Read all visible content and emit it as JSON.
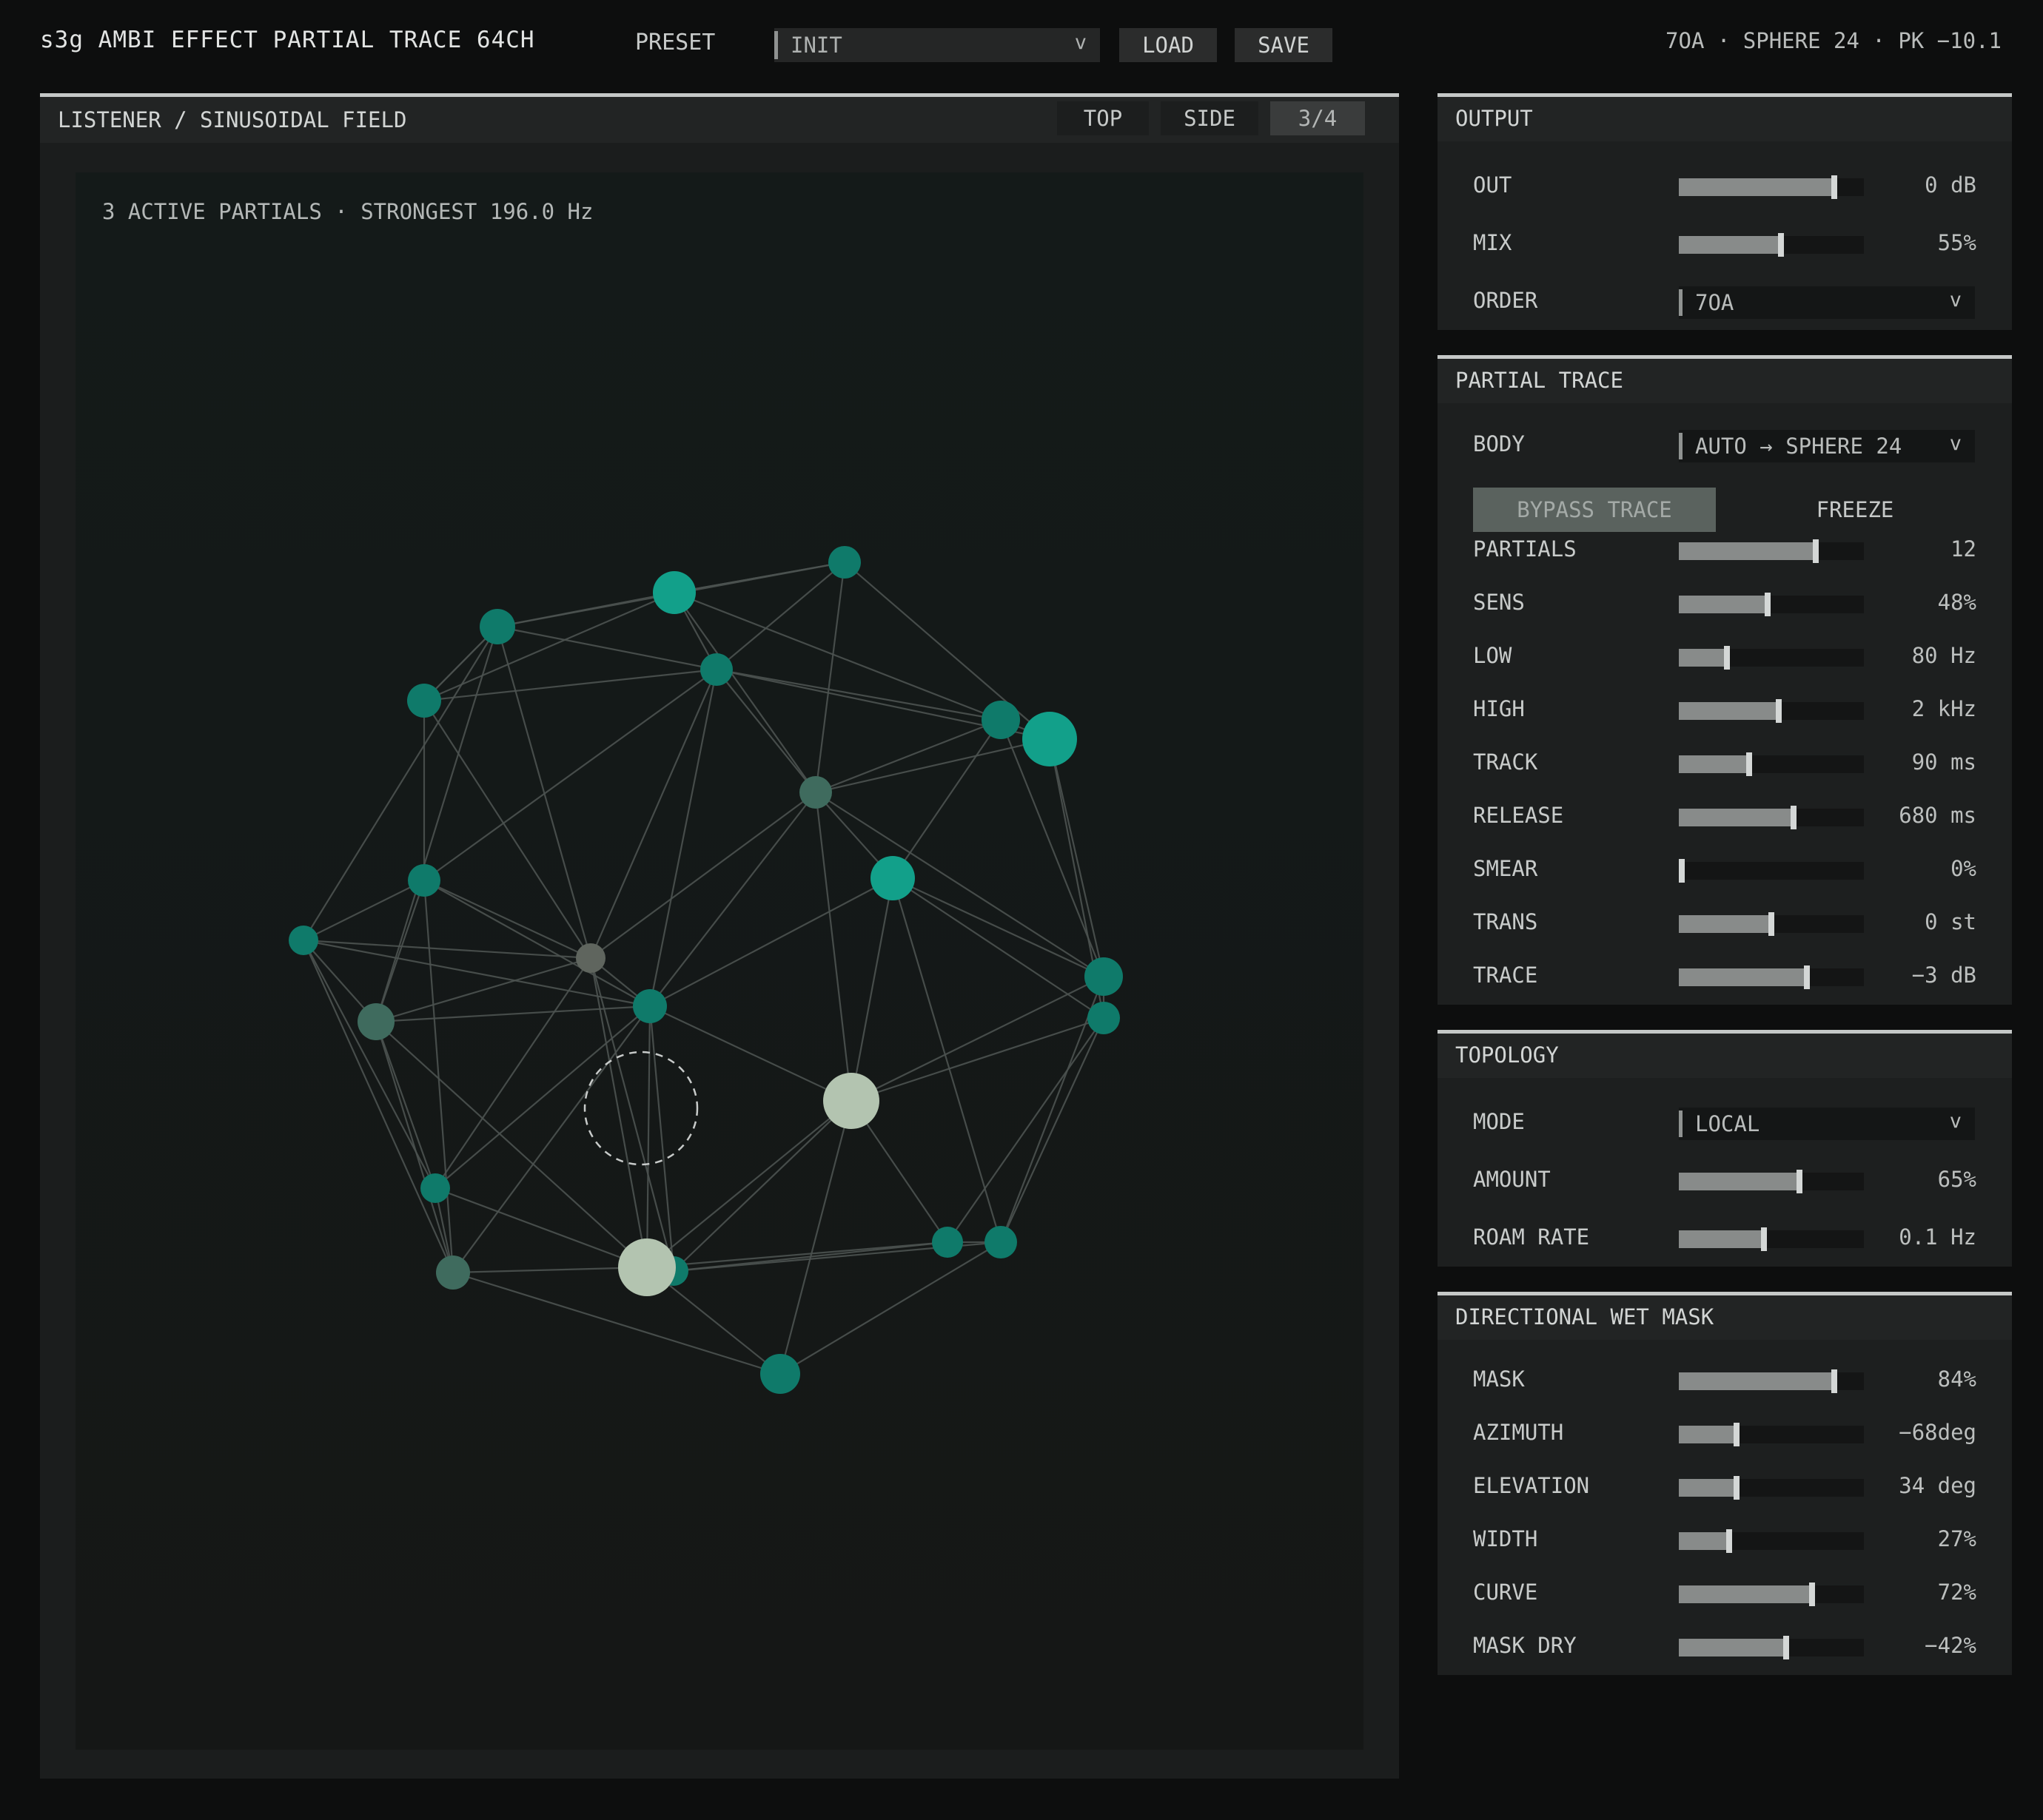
{
  "header": {
    "title": "s3g AMBI EFFECT PARTIAL TRACE 64CH",
    "preset_label": "PRESET",
    "preset_value": "INIT",
    "load_label": "LOAD",
    "save_label": "SAVE",
    "status": "7OA · SPHERE 24 · PK −10.1"
  },
  "field": {
    "title": "LISTENER / SINUSOIDAL FIELD",
    "tabs": [
      "TOP",
      "SIDE",
      "3/4"
    ],
    "active_tab": "3/4",
    "readout": "3 ACTIVE PARTIALS · STRONGEST 196.0 Hz"
  },
  "output": {
    "title": "OUTPUT",
    "out": {
      "label": "OUT",
      "value": "0 dB",
      "level": 0.84
    },
    "mix": {
      "label": "MIX",
      "value": "55%",
      "level": 0.55
    },
    "order": {
      "label": "ORDER",
      "value": "7OA"
    }
  },
  "trace": {
    "title": "PARTIAL TRACE",
    "body": {
      "label": "BODY",
      "value": "AUTO → SPHERE 24"
    },
    "bypass_label": "BYPASS TRACE",
    "freeze_label": "FREEZE",
    "params": [
      {
        "label": "PARTIALS",
        "value": "12",
        "level": 0.74
      },
      {
        "label": "SENS",
        "value": "48%",
        "level": 0.48
      },
      {
        "label": "LOW",
        "value": "80 Hz",
        "level": 0.26
      },
      {
        "label": "HIGH",
        "value": "2 kHz",
        "level": 0.54
      },
      {
        "label": "TRACK",
        "value": "90 ms",
        "level": 0.38
      },
      {
        "label": "RELEASE",
        "value": "680 ms",
        "level": 0.62
      },
      {
        "label": "SMEAR",
        "value": "0%",
        "level": 0.0
      },
      {
        "label": "TRANS",
        "value": "0 st",
        "level": 0.5
      },
      {
        "label": "TRACE",
        "value": "−3 dB",
        "level": 0.69
      }
    ]
  },
  "topology": {
    "title": "TOPOLOGY",
    "mode": {
      "label": "MODE",
      "value": "LOCAL"
    },
    "params": [
      {
        "label": "AMOUNT",
        "value": "65%",
        "level": 0.65
      },
      {
        "label": "ROAM RATE",
        "value": "0.1 Hz",
        "level": 0.46
      }
    ]
  },
  "mask": {
    "title": "DIRECTIONAL WET MASK",
    "params": [
      {
        "label": "MASK",
        "value": "84%",
        "level": 0.84
      },
      {
        "label": "AZIMUTH",
        "value": "−68deg",
        "level": 0.31
      },
      {
        "label": "ELEVATION",
        "value": "34 deg",
        "level": 0.31
      },
      {
        "label": "WIDTH",
        "value": "27%",
        "level": 0.27
      },
      {
        "label": "CURVE",
        "value": "72%",
        "level": 0.72
      },
      {
        "label": "MASK DRY",
        "value": "−42%",
        "level": 0.58
      }
    ]
  },
  "colors": {
    "node_teal": "#0f7a6a",
    "node_bright": "#12a08a",
    "node_pale": "#b3c4b0",
    "node_muted": "#3f6b5e",
    "node_grey": "#5f655e",
    "edge": "#4b5250"
  }
}
